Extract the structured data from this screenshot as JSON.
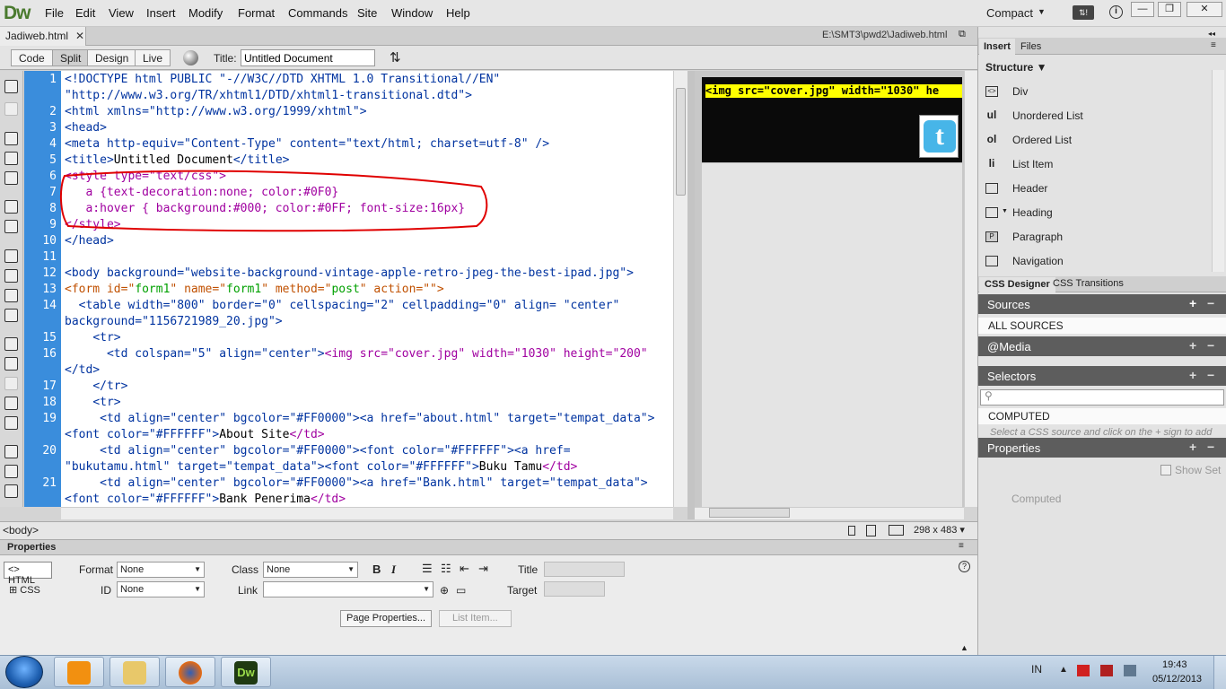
{
  "app": {
    "logo": "Dw",
    "menus": [
      "File",
      "Edit",
      "View",
      "Insert",
      "Modify",
      "Format",
      "Commands",
      "Site",
      "Window",
      "Help"
    ],
    "workspace": "Compact",
    "sync_label": "⇅!"
  },
  "document": {
    "tab": "Jadiweb.html",
    "path": "E:\\SMT3\\pwd2\\Jadiweb.html",
    "view_buttons": [
      "Code",
      "Split",
      "Design",
      "Live"
    ],
    "active_view": "Split",
    "title_label": "Title:",
    "title_value": "Untitled Document"
  },
  "code": {
    "line_numbers": [
      "1",
      "",
      "2",
      "3",
      "4",
      "5",
      "6",
      "7",
      "8",
      "9",
      "10",
      "11",
      "12",
      "13",
      "14",
      "",
      "15",
      "16",
      "",
      "17",
      "18",
      "19",
      "",
      "20",
      "",
      "21",
      ""
    ]
  },
  "design_view": {
    "tag_text": "<img src=\"cover.jpg\" width=\"1030\" he",
    "twitter_glyph": "t"
  },
  "status": {
    "tag": "<body>",
    "dimensions": "298 x 483 ▾"
  },
  "properties": {
    "title": "Properties",
    "html_btn": "HTML",
    "css_btn": "CSS",
    "format_label": "Format",
    "format_value": "None",
    "class_label": "Class",
    "class_value": "None",
    "title_label": "Title",
    "id_label": "ID",
    "id_value": "None",
    "link_label": "Link",
    "link_value": "",
    "target_label": "Target",
    "bold": "B",
    "italic": "I",
    "page_properties": "Page Properties...",
    "list_item": "List Item..."
  },
  "insert_panel": {
    "tabs": [
      "Insert",
      "Files"
    ],
    "category": "Structure",
    "items": [
      {
        "icon": "div-icon",
        "glyph": "<>",
        "label": "Div"
      },
      {
        "icon": "unordered-list-icon",
        "glyph": "ul",
        "label": "Unordered List"
      },
      {
        "icon": "ordered-list-icon",
        "glyph": "ol",
        "label": "Ordered List"
      },
      {
        "icon": "list-item-icon",
        "glyph": "li",
        "label": "List Item"
      },
      {
        "icon": "header-icon",
        "glyph": "",
        "label": "Header"
      },
      {
        "icon": "heading-icon",
        "glyph": "",
        "label": "Heading"
      },
      {
        "icon": "paragraph-icon",
        "glyph": "P",
        "label": "Paragraph"
      },
      {
        "icon": "navigation-icon",
        "glyph": "",
        "label": "Navigation"
      }
    ]
  },
  "css_designer": {
    "tabs": [
      "CSS Designer",
      "CSS Transitions"
    ],
    "sources": "Sources",
    "all_sources": "ALL SOURCES",
    "media": "@Media",
    "selectors": "Selectors",
    "computed_row": "COMPUTED",
    "hint": "Select a CSS source and click on the + sign to add",
    "properties": "Properties",
    "show_set": "Show Set",
    "computed": "Computed"
  },
  "taskbar": {
    "lang": "IN",
    "time": "19:43",
    "date": "05/12/2013"
  },
  "colors": {
    "gutter": "#3a8ddc",
    "tag_blue": "#0033a0",
    "attr_orange": "#c05000",
    "string_green": "#00a000",
    "annotation_red": "#e00000",
    "highlight_yellow": "#ffff00"
  }
}
